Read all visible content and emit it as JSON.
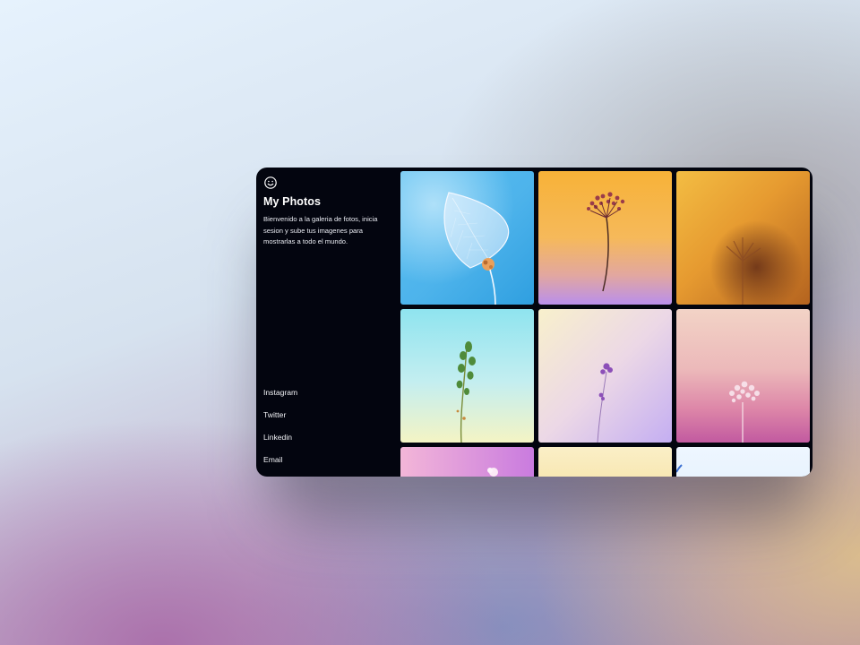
{
  "app": {
    "logo_icon": "smiley-face-icon",
    "title": "My Photos",
    "description": "Bienvenido a la galeria de fotos, inicia sesion y sube tus imagenes para mostrarlas a todo el mundo."
  },
  "social_links": [
    {
      "label": "Instagram"
    },
    {
      "label": "Twitter"
    },
    {
      "label": "Linkedin"
    },
    {
      "label": "Email"
    }
  ],
  "gallery": {
    "photos": [
      {
        "subject": "skeleton leaf on blue background",
        "colors": [
          "#35a8e3",
          "#a8def7"
        ]
      },
      {
        "subject": "dried flower on orange-lilac background",
        "colors": [
          "#f7b33f",
          "#bd92ea"
        ]
      },
      {
        "subject": "blurred plant on amber background",
        "colors": [
          "#d68a29",
          "#f4c24d"
        ]
      },
      {
        "subject": "green sprig on aqua background",
        "colors": [
          "#8fe6ef",
          "#f4f4c6"
        ]
      },
      {
        "subject": "purple flower on pastel background",
        "colors": [
          "#f4ebc9",
          "#c8b0f0"
        ]
      },
      {
        "subject": "pale plant on pink background",
        "colors": [
          "#efcbc5",
          "#c95c9f"
        ]
      },
      {
        "subject": "flower on pink-violet background",
        "colors": [
          "#f1b4da",
          "#c978de"
        ]
      },
      {
        "subject": "pale yellow background",
        "colors": [
          "#f9eac0",
          "#f3d177"
        ]
      },
      {
        "subject": "light blue background",
        "colors": [
          "#eef7ff",
          "#d8eafb"
        ]
      }
    ]
  },
  "colors": {
    "panel_background": "#03050f",
    "text": "#ffffff",
    "divider": "#3a3f4d"
  }
}
